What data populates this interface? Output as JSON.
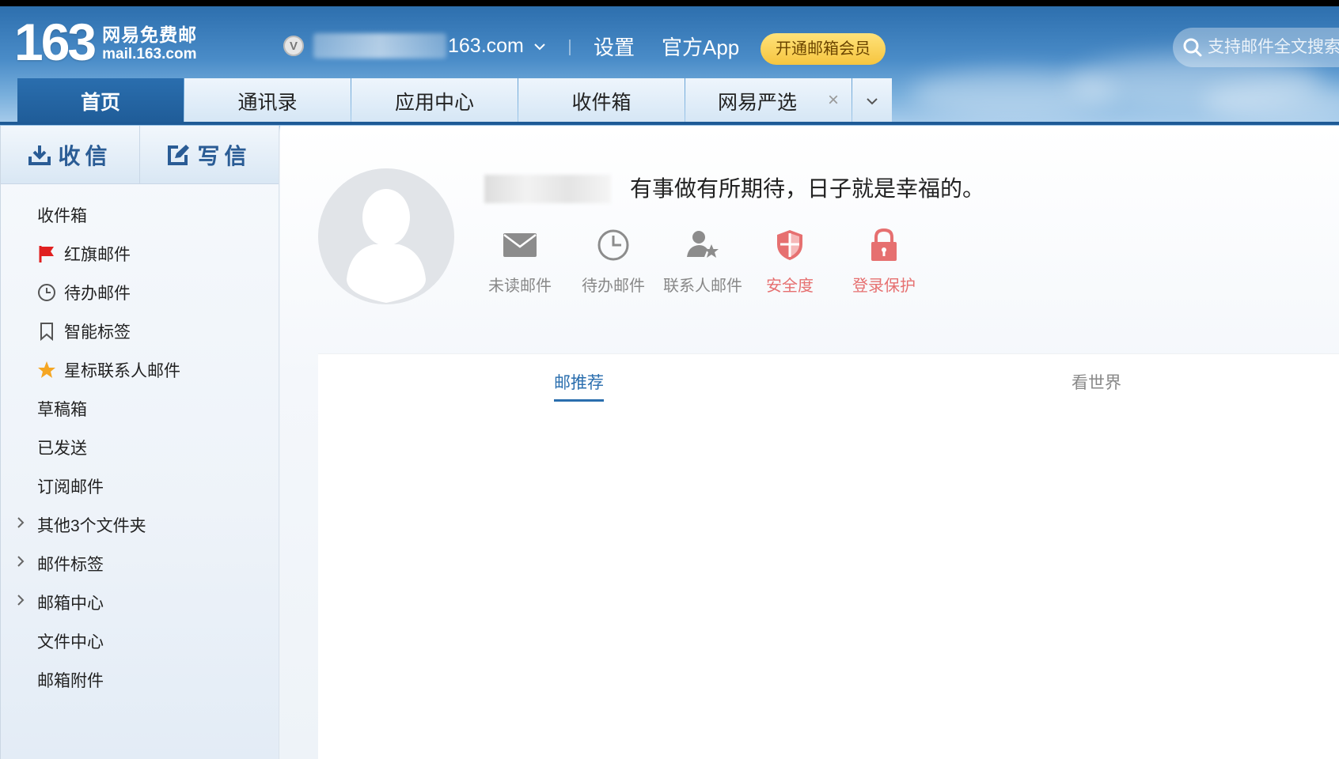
{
  "header": {
    "logo_number": "163",
    "logo_cn": "网易免费邮",
    "logo_en": "mail.163.com",
    "vip_badge": "V",
    "account_domain": "163.com",
    "links": [
      "设置",
      "官方App"
    ],
    "vip_button": "开通邮箱会员",
    "search_placeholder": "支持邮件全文搜索"
  },
  "tabs": [
    {
      "label": "首页",
      "active": true
    },
    {
      "label": "通讯录"
    },
    {
      "label": "应用中心"
    },
    {
      "label": "收件箱"
    },
    {
      "label": "网易严选",
      "closable": true,
      "close_glyph": "×"
    }
  ],
  "sidebar": {
    "receive_label": "收信",
    "compose_label": "写信",
    "items": [
      {
        "label": "收件箱"
      },
      {
        "label": "红旗邮件",
        "icon": "red-flag-icon"
      },
      {
        "label": "待办邮件",
        "icon": "clock-icon"
      },
      {
        "label": "智能标签",
        "icon": "bookmark-icon"
      },
      {
        "label": "星标联系人邮件",
        "icon": "star-icon"
      },
      {
        "label": "草稿箱"
      },
      {
        "label": "已发送"
      },
      {
        "label": "订阅邮件"
      },
      {
        "label": "其他3个文件夹",
        "expandable": true
      },
      {
        "label": "邮件标签",
        "expandable": true
      },
      {
        "label": "邮箱中心",
        "expandable": true
      },
      {
        "label": "文件中心"
      },
      {
        "label": "邮箱附件"
      }
    ]
  },
  "main": {
    "motto": "有事做有所期待，日子就是幸福的。",
    "quick_links": [
      {
        "label": "未读邮件",
        "icon": "envelope-icon"
      },
      {
        "label": "待办邮件",
        "icon": "clock-icon"
      },
      {
        "label": "联系人邮件",
        "icon": "contact-star-icon"
      },
      {
        "label": "安全度",
        "icon": "shield-icon"
      },
      {
        "label": "登录保护",
        "icon": "lock-icon"
      }
    ],
    "panel_tabs": [
      {
        "label": "邮推荐",
        "active": true
      },
      {
        "label": "看世界"
      }
    ]
  },
  "colors": {
    "brand_blue": "#1f5c98",
    "vip_gold": "#f6c53f",
    "warn_red": "#e67070",
    "flag_red": "#e02020",
    "star_orange": "#f5a623"
  }
}
